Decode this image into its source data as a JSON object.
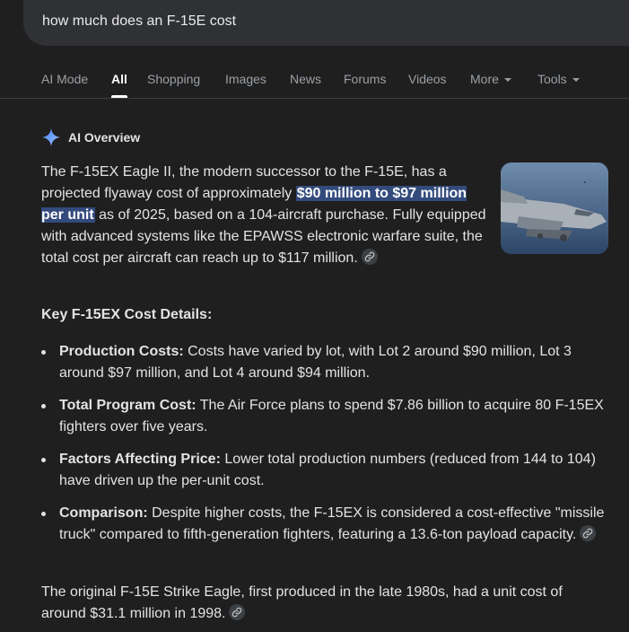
{
  "search": {
    "query": "how much does an F-15E cost"
  },
  "tabs": [
    {
      "label": "AI Mode"
    },
    {
      "label": "All"
    },
    {
      "label": "Shopping"
    },
    {
      "label": "Images"
    },
    {
      "label": "News"
    },
    {
      "label": "Forums"
    },
    {
      "label": "Videos"
    },
    {
      "label": "More"
    },
    {
      "label": "Tools"
    }
  ],
  "overview": {
    "title": "AI Overview",
    "intro_part1": "The F-15EX Eagle II, the modern successor to the F-15E, has a projected flyaway cost of approximately ",
    "intro_highlight": "$90 million to $97 million per unit",
    "intro_part2": " as of 2025, based on a 104-aircraft purchase. Fully equipped with advanced systems like the EPAWSS electronic warfare suite, the total cost per aircraft can reach up to $117 million.",
    "key_title": "Key F-15EX Cost Details:",
    "bullets": [
      {
        "label": "Production Costs:",
        "text": " Costs have varied by lot, with Lot 2 around $90 million, Lot 3 around $97 million, and Lot 4 around $94 million."
      },
      {
        "label": "Total Program Cost:",
        "text": " The Air Force plans to spend $7.86 billion to acquire 80 F-15EX fighters over five years."
      },
      {
        "label": "Factors Affecting Price:",
        "text": " Lower total production numbers (reduced from 144 to 104) have driven up the per-unit cost."
      },
      {
        "label": "Comparison:",
        "text": " Despite higher costs, the F-15EX is considered a cost-effective \"missile truck\" compared to fifth-generation fighters, featuring a 13.6-ton payload capacity."
      }
    ],
    "outro": "The original F-15E Strike Eagle, first produced in the late 1980s, had a unit cost of around $31.1 million in 1998."
  },
  "colors": {
    "background": "#1f1f1f",
    "search_bar": "#303134",
    "highlight": "#334a7d",
    "gemini_spark": "#8ab4f8"
  },
  "icons": {
    "overview": "gemini-spark-icon",
    "link": "link-icon",
    "dropdown": "caret-down-icon"
  }
}
